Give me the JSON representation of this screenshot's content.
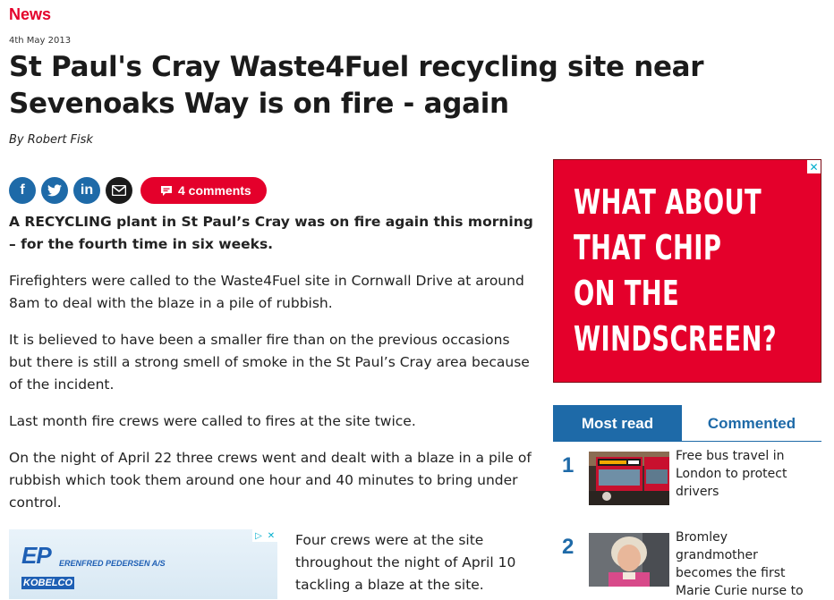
{
  "section": "News",
  "date": "4th May 2013",
  "headline": "St Paul's Cray Waste4Fuel recycling site near Sevenoaks Way is on fire - again",
  "byline": "By Robert Fisk",
  "share": {
    "facebook_icon": "f",
    "twitter_icon": "t",
    "linkedin_icon": "in",
    "email_icon": "envelope-icon",
    "comments_label": "4 comments"
  },
  "article": {
    "paragraphs": [
      "A RECYCLING plant in St Paul’s Cray was on fire again this morning – for the fourth time in six weeks.",
      "Firefighters were called to the Waste4Fuel site in Cornwall Drive at around 8am to deal with the blaze in a pile of rubbish.",
      "It is believed to have been a smaller fire than on the previous occasions but there is still a strong smell of smoke in the St Paul’s Cray area because of the incident.",
      "Last month fire crews were called to fires at the site twice.",
      "On the night of April 22 three crews went and dealt with a blaze in a pile of rubbish which took them around one hour and 40 minutes to bring under control."
    ],
    "after_ad_paragraph": "Four crews were at the site throughout the night of April 10 tackling a blaze at the site."
  },
  "inline_ad": {
    "logo_mark": "EP",
    "company": "ERENFRED PEDERSEN A/S",
    "partner": "KOBELCO"
  },
  "side_ad": {
    "lines": [
      "WHAT ABOUT",
      "THAT CHIP",
      "ON THE",
      "WINDSCREEN?"
    ],
    "background": "#e4002b"
  },
  "tabs": {
    "most_read": "Most read",
    "commented": "Commented"
  },
  "most_read": [
    {
      "rank": "1",
      "title": "Free bus travel in London to protect drivers",
      "thumb": "bus-photo"
    },
    {
      "rank": "2",
      "title": "Bromley grandmother becomes the first Marie Curie nurse to",
      "thumb": "woman-portrait-photo"
    }
  ],
  "colors": {
    "brand_red": "#e4002b",
    "brand_blue": "#1e6aa8"
  }
}
